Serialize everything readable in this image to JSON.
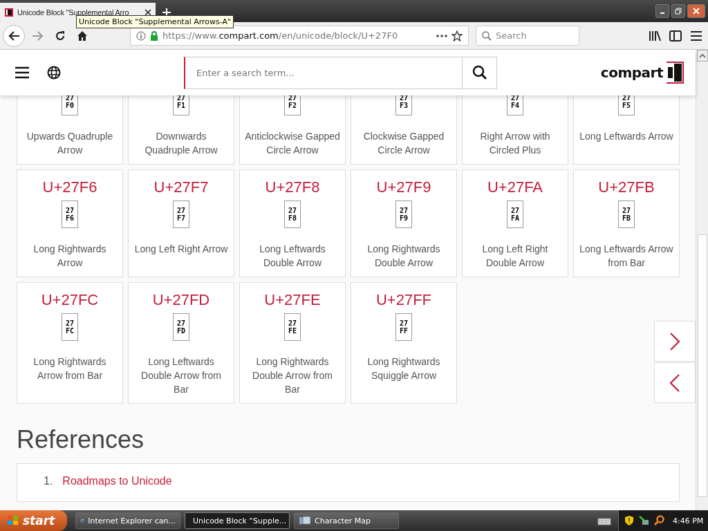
{
  "browser": {
    "tabs": [
      {
        "title": "Unicode Block \"Supplemental Arro",
        "selected": true
      }
    ],
    "tooltip": "Unicode Block \"Supplemental Arrows-A\"",
    "url": {
      "scheme": "https://www.",
      "domain": "compart.com",
      "path": "/en/unicode/block/U+27F0"
    },
    "search": {
      "placeholder": "Search"
    }
  },
  "header": {
    "search": {
      "placeholder": "Enter a search term..."
    },
    "logo": "compart"
  },
  "characters": [
    {
      "glyph": [
        "27",
        "F0"
      ],
      "name": "Upwards Quadruple Arrow"
    },
    {
      "glyph": [
        "27",
        "F1"
      ],
      "name": "Downwards Quadruple Arrow"
    },
    {
      "glyph": [
        "27",
        "F2"
      ],
      "name": "Anticlockwise Gapped Circle Arrow"
    },
    {
      "glyph": [
        "27",
        "F3"
      ],
      "name": "Clockwise Gapped Circle Arrow"
    },
    {
      "glyph": [
        "27",
        "F4"
      ],
      "name": "Right Arrow with Circled Plus"
    },
    {
      "glyph": [
        "27",
        "F5"
      ],
      "name": "Long Leftwards Arrow"
    },
    {
      "code": "U+27F6",
      "glyph": [
        "27",
        "F6"
      ],
      "name": "Long Rightwards Arrow"
    },
    {
      "code": "U+27F7",
      "glyph": [
        "27",
        "F7"
      ],
      "name": "Long Left Right Arrow"
    },
    {
      "code": "U+27F8",
      "glyph": [
        "27",
        "F8"
      ],
      "name": "Long Leftwards Double Arrow"
    },
    {
      "code": "U+27F9",
      "glyph": [
        "27",
        "F9"
      ],
      "name": "Long Rightwards Double Arrow"
    },
    {
      "code": "U+27FA",
      "glyph": [
        "27",
        "FA"
      ],
      "name": "Long Left Right Double Arrow"
    },
    {
      "code": "U+27FB",
      "glyph": [
        "27",
        "FB"
      ],
      "name": "Long Leftwards Arrow from Bar"
    },
    {
      "code": "U+27FC",
      "glyph": [
        "27",
        "FC"
      ],
      "name": "Long Rightwards Arrow from Bar"
    },
    {
      "code": "U+27FD",
      "glyph": [
        "27",
        "FD"
      ],
      "name": "Long Leftwards Double Arrow from Bar"
    },
    {
      "code": "U+27FE",
      "glyph": [
        "27",
        "FE"
      ],
      "name": "Long Rightwards Double Arrow from Bar"
    },
    {
      "code": "U+27FF",
      "glyph": [
        "27",
        "FF"
      ],
      "name": "Long Rightwards Squiggle Arrow"
    }
  ],
  "references": {
    "heading": "References",
    "items": [
      {
        "number": "1.",
        "label": "Roadmaps to Unicode"
      }
    ]
  },
  "taskbar": {
    "start": "start",
    "tasks": [
      {
        "kind": "ie",
        "label": "Internet Explorer can...",
        "selected": false
      },
      {
        "kind": "firefox",
        "label": "Unicode Block “Supple...",
        "selected": true
      },
      {
        "kind": "charmap",
        "label": "Character Map",
        "selected": false
      }
    ],
    "clock": "4:46 PM"
  }
}
